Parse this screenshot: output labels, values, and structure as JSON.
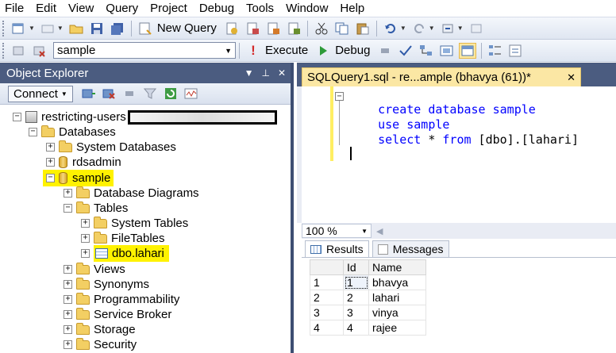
{
  "menu": [
    "File",
    "Edit",
    "View",
    "Query",
    "Project",
    "Debug",
    "Tools",
    "Window",
    "Help"
  ],
  "toolbar": {
    "new_query_label": "New Query",
    "database_selected": "sample",
    "execute_label": "Execute",
    "debug_label": "Debug"
  },
  "object_explorer": {
    "title": "Object Explorer",
    "pin_glyph": "▾ ⊥ ✕",
    "connect_label": "Connect",
    "tree": {
      "server": "restricting-users",
      "databases": "Databases",
      "system_databases": "System Databases",
      "rdsadmin": "rdsadmin",
      "sample": "sample",
      "database_diagrams": "Database Diagrams",
      "tables": "Tables",
      "system_tables": "System Tables",
      "file_tables": "FileTables",
      "table_lahari": "dbo.lahari",
      "views": "Views",
      "synonyms": "Synonyms",
      "programmability": "Programmability",
      "service_broker": "Service Broker",
      "storage": "Storage",
      "security": "Security"
    }
  },
  "editor": {
    "tab_title": "SQLQuery1.sql - re...ample (bhavya (61))*",
    "tab_close": "✕",
    "lines": [
      {
        "kw": "create database sample",
        "rest": ""
      },
      {
        "kw": "use sample",
        "rest": ""
      },
      {
        "kw": "select",
        "rest": " * ",
        "kw2": "from",
        "rest2": " [dbo].[lahari]"
      }
    ],
    "zoom": "100 %"
  },
  "results": {
    "tabs": [
      "Results",
      "Messages"
    ],
    "columns": [
      "Id",
      "Name"
    ],
    "rows": [
      {
        "row": "1",
        "id": "1",
        "name": "bhavya"
      },
      {
        "row": "2",
        "id": "2",
        "name": "lahari"
      },
      {
        "row": "3",
        "id": "3",
        "name": "vinya"
      },
      {
        "row": "4",
        "id": "4",
        "name": "rajee"
      }
    ]
  },
  "colors": {
    "panel_header": "#4b5c80",
    "highlight": "#fff200",
    "keyword": "#0000ff",
    "active_tab": "#fbe7a4"
  }
}
